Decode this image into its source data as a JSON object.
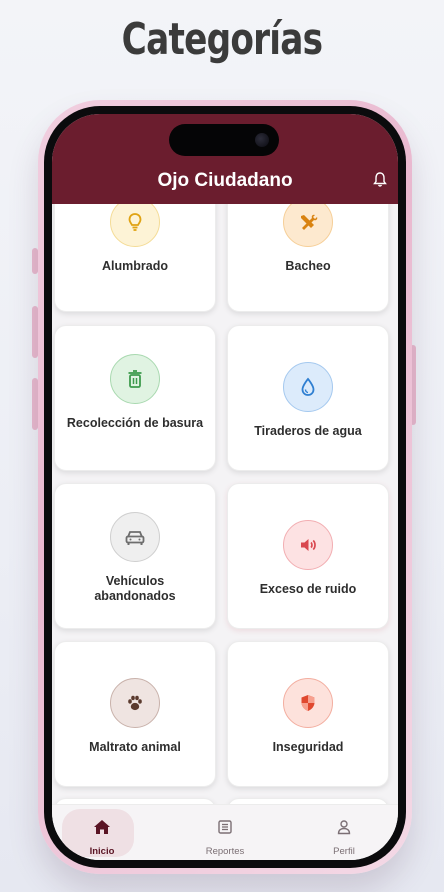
{
  "heading": "Categorías",
  "app": {
    "title": "Ojo Ciudadano",
    "accent": "#6b1d2e"
  },
  "categories": [
    {
      "label": "Alumbrado",
      "icon": "lightbulb-icon",
      "color": "#e0a313",
      "bg": "#fdf3d6"
    },
    {
      "label": "Bacheo",
      "icon": "tools-icon",
      "color": "#d98311",
      "bg": "#fde9cf"
    },
    {
      "label": "Recolección de basura",
      "icon": "trash-icon",
      "color": "#3e9b4e",
      "bg": "#e0f3e2"
    },
    {
      "label": "Tiraderos de agua",
      "icon": "water-drop-icon",
      "color": "#2f7fd1",
      "bg": "#dcebfb"
    },
    {
      "label": "Vehículos abandonados",
      "icon": "car-icon",
      "color": "#6d6d6d",
      "bg": "#efefef"
    },
    {
      "label": "Exceso de ruido",
      "icon": "speaker-icon",
      "color": "#d9474f",
      "bg": "#fde2e3"
    },
    {
      "label": "Maltrato animal",
      "icon": "paw-icon",
      "color": "#5b3a2e",
      "bg": "#efe4e1"
    },
    {
      "label": "Inseguridad",
      "icon": "shield-icon",
      "color": "#e0482f",
      "bg": "#fde2dc"
    }
  ],
  "nav": {
    "items": [
      {
        "label": "Inicio",
        "icon": "home-icon",
        "active": true
      },
      {
        "label": "Reportes",
        "icon": "reports-icon",
        "active": false
      },
      {
        "label": "Perfil",
        "icon": "profile-icon",
        "active": false
      }
    ]
  }
}
